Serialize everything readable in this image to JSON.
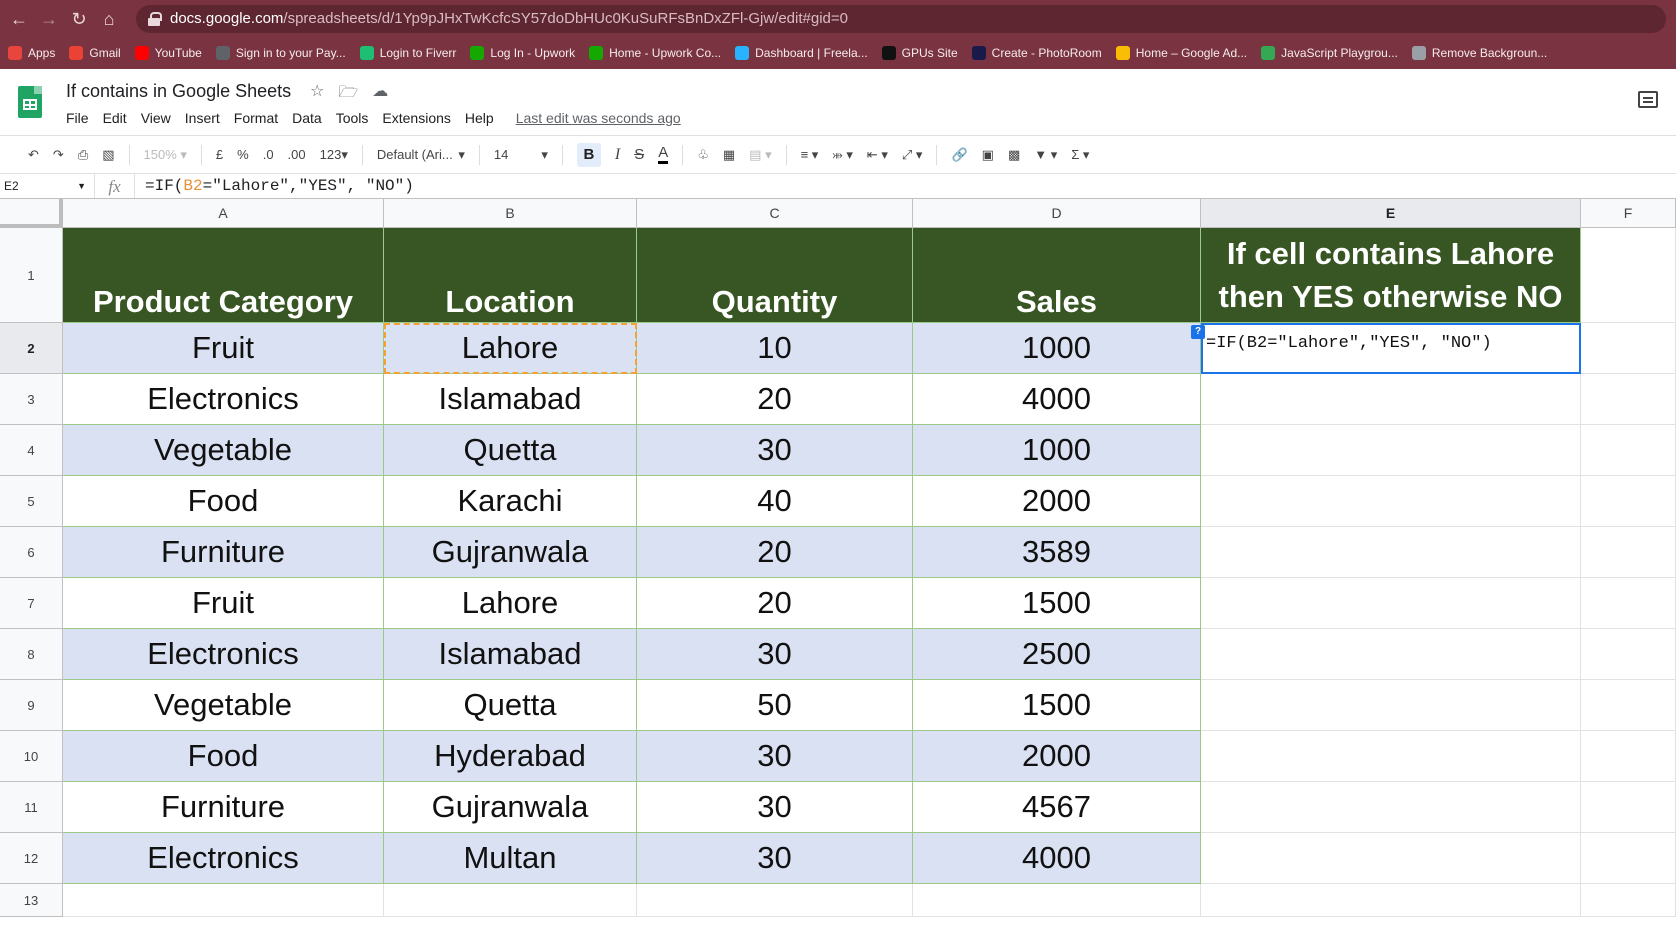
{
  "browser": {
    "url_host": "docs.google.com",
    "url_path": "/spreadsheets/d/1Yp9pJHxTwKcfcSY57doDbHUc0KuSuRFsBnDxZFl-Gjw/edit#gid=0",
    "bookmarks": [
      {
        "label": "Apps",
        "color": "#e8453c"
      },
      {
        "label": "Gmail",
        "color": "#ea4335"
      },
      {
        "label": "YouTube",
        "color": "#ff0000"
      },
      {
        "label": "Sign in to your Pay...",
        "color": "#5f6368"
      },
      {
        "label": "Login to Fiverr",
        "color": "#1dbf73"
      },
      {
        "label": "Log In - Upwork",
        "color": "#14a800"
      },
      {
        "label": "Home - Upwork Co...",
        "color": "#14a800"
      },
      {
        "label": "Dashboard | Freela...",
        "color": "#29b2fe"
      },
      {
        "label": "GPUs Site",
        "color": "#111111"
      },
      {
        "label": "Create - PhotoRoom",
        "color": "#1a1a4a"
      },
      {
        "label": "Home – Google Ad...",
        "color": "#fbbc04"
      },
      {
        "label": "JavaScript Playgrou...",
        "color": "#34a853"
      },
      {
        "label": "Remove Backgroun...",
        "color": "#9aa0a6"
      }
    ]
  },
  "sheets": {
    "doc_title": "If contains in Google Sheets",
    "menus": [
      "File",
      "Edit",
      "View",
      "Insert",
      "Format",
      "Data",
      "Tools",
      "Extensions",
      "Help"
    ],
    "last_edit": "Last edit was seconds ago"
  },
  "toolbar": {
    "zoom": "150%",
    "currency": "£",
    "percent": "%",
    "dec_decrease": ".0",
    "dec_increase": ".00",
    "more_formats": "123",
    "font": "Default (Ari...",
    "font_size": "14",
    "bold": "B",
    "italic": "I",
    "strike": "S",
    "text_color": "A"
  },
  "formula_bar": {
    "cell_ref": "E2",
    "fx": "fx",
    "formula_prefix": "=IF(",
    "formula_ref": "B2",
    "formula_suffix": "=\"Lahore\",\"YES\",  \"NO\")"
  },
  "grid": {
    "columns": [
      "A",
      "B",
      "C",
      "D",
      "E",
      "F"
    ],
    "rows": [
      "1",
      "2",
      "3",
      "4",
      "5",
      "6",
      "7",
      "8",
      "9",
      "10",
      "11",
      "12",
      "13"
    ],
    "headers": [
      "Product Category",
      "Location",
      "Quantity",
      "Sales"
    ],
    "header_e_line1": "If cell contains Lahore",
    "header_e_line2": "then YES otherwise NO",
    "data": [
      [
        "Fruit",
        "Lahore",
        "10",
        "1000"
      ],
      [
        "Electronics",
        "Islamabad",
        "20",
        "4000"
      ],
      [
        "Vegetable",
        "Quetta",
        "30",
        "1000"
      ],
      [
        "Food",
        "Karachi",
        "40",
        "2000"
      ],
      [
        "Furniture",
        "Gujranwala",
        "20",
        "3589"
      ],
      [
        "Fruit",
        "Lahore",
        "20",
        "1500"
      ],
      [
        "Electronics",
        "Islamabad",
        "30",
        "2500"
      ],
      [
        "Vegetable",
        "Quetta",
        "50",
        "1500"
      ],
      [
        "Food",
        "Hyderabad",
        "30",
        "2000"
      ],
      [
        "Furniture",
        "Gujranwala",
        "30",
        "4567"
      ],
      [
        "Electronics",
        "Multan",
        "30",
        "4000"
      ]
    ],
    "active_cell_formula": "=IF(B2=\"Lahore\",\"YES\",  \"NO\")",
    "help_badge": "?",
    "colors": {
      "header_fill": "#375623",
      "band_fill": "#dae1f3",
      "border_green": "#9bc98a",
      "active_blue": "#1a73e8",
      "copy_orange": "#f4a233"
    }
  }
}
